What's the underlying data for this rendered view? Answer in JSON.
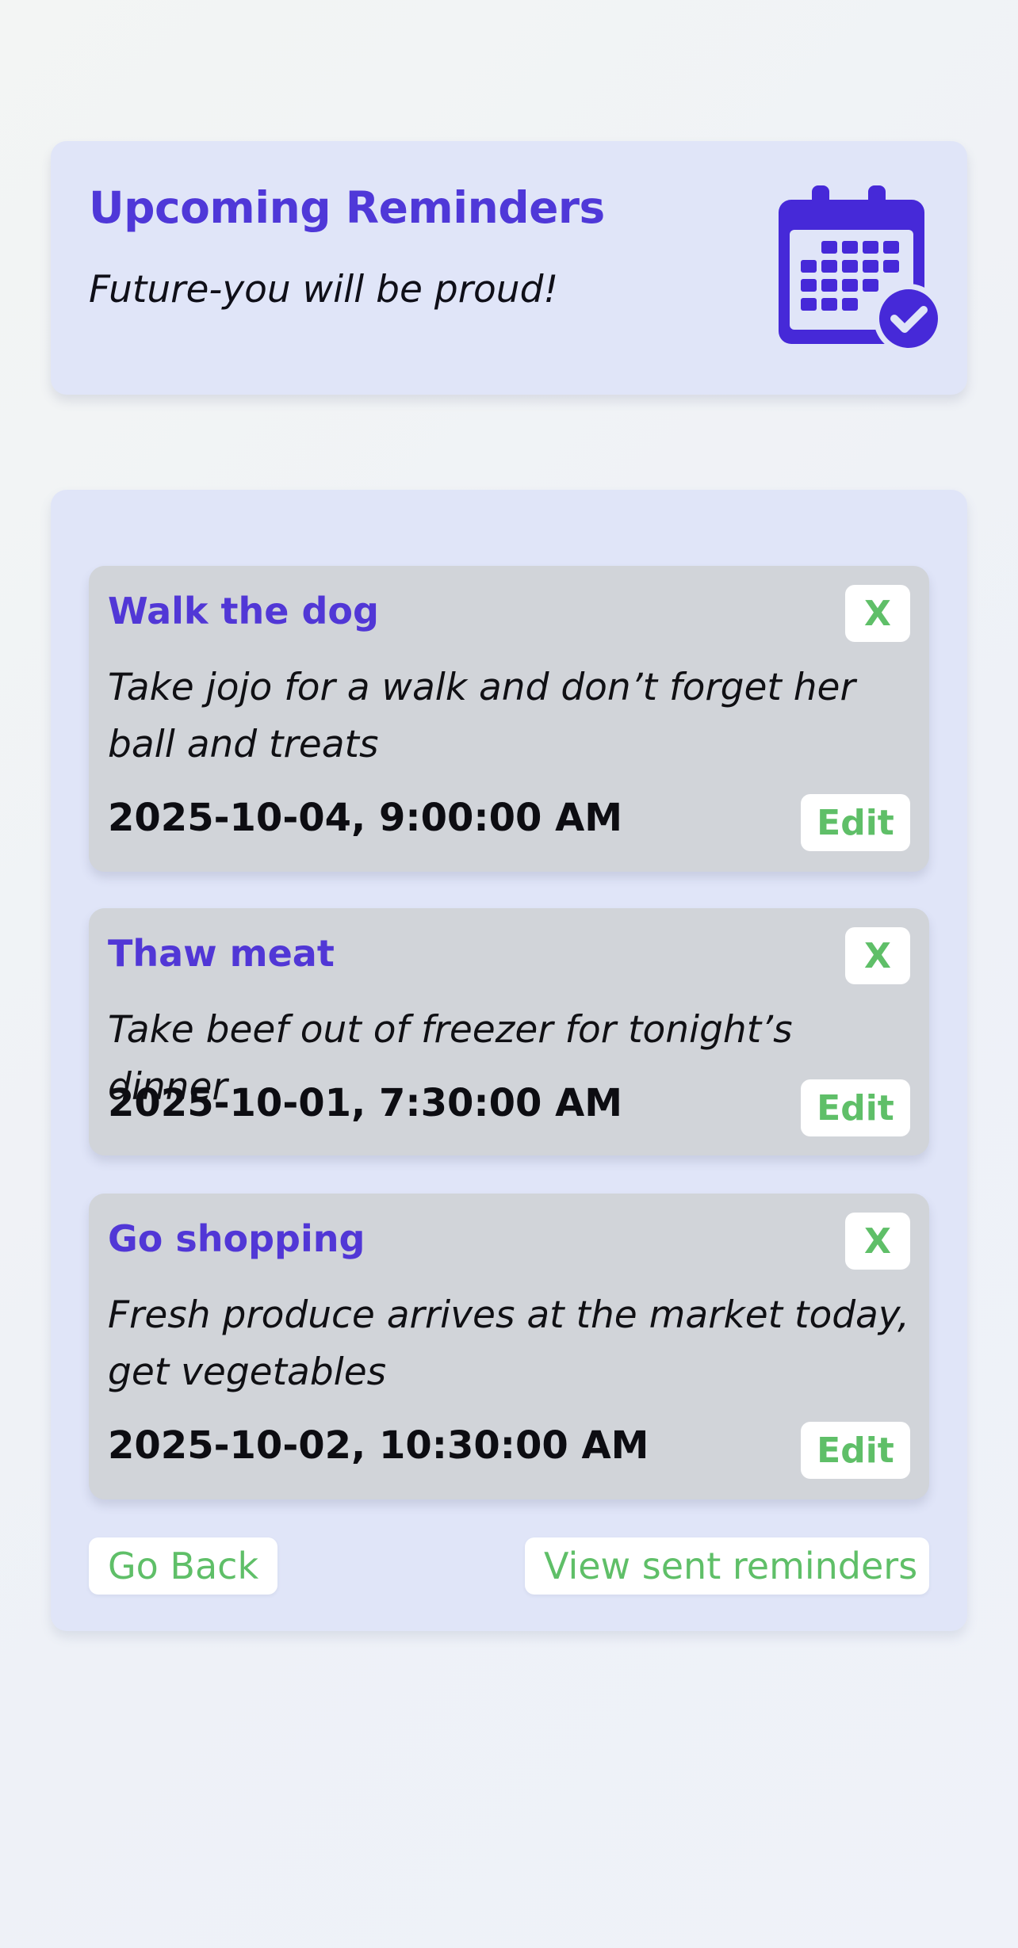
{
  "header": {
    "title": "Upcoming Reminders",
    "subtitle": "Future-you will be proud!",
    "icon": "calendar-check-icon"
  },
  "reminders": [
    {
      "title": "Walk the dog",
      "description": "Take jojo for a walk and don’t forget her ball and treats",
      "datetime": "2025-10-04, 9:00:00 AM",
      "delete_label": "X",
      "edit_label": "Edit"
    },
    {
      "title": "Thaw meat",
      "description": "Take beef out of freezer for tonight’s dinner",
      "datetime": "2025-10-01, 7:30:00 AM",
      "delete_label": "X",
      "edit_label": "Edit"
    },
    {
      "title": "Go shopping",
      "description": "Fresh produce arrives at the market today, get vegetables",
      "datetime": "2025-10-02, 10:30:00 AM",
      "delete_label": "X",
      "edit_label": "Edit"
    }
  ],
  "footer": {
    "go_back_label": "Go Back",
    "view_sent_label": "View sent reminders"
  },
  "colors": {
    "accent": "#4f38d8",
    "button_text": "#5fbf68",
    "card_bg": "#e0e5f8",
    "reminder_bg": "#d1d4d9"
  }
}
